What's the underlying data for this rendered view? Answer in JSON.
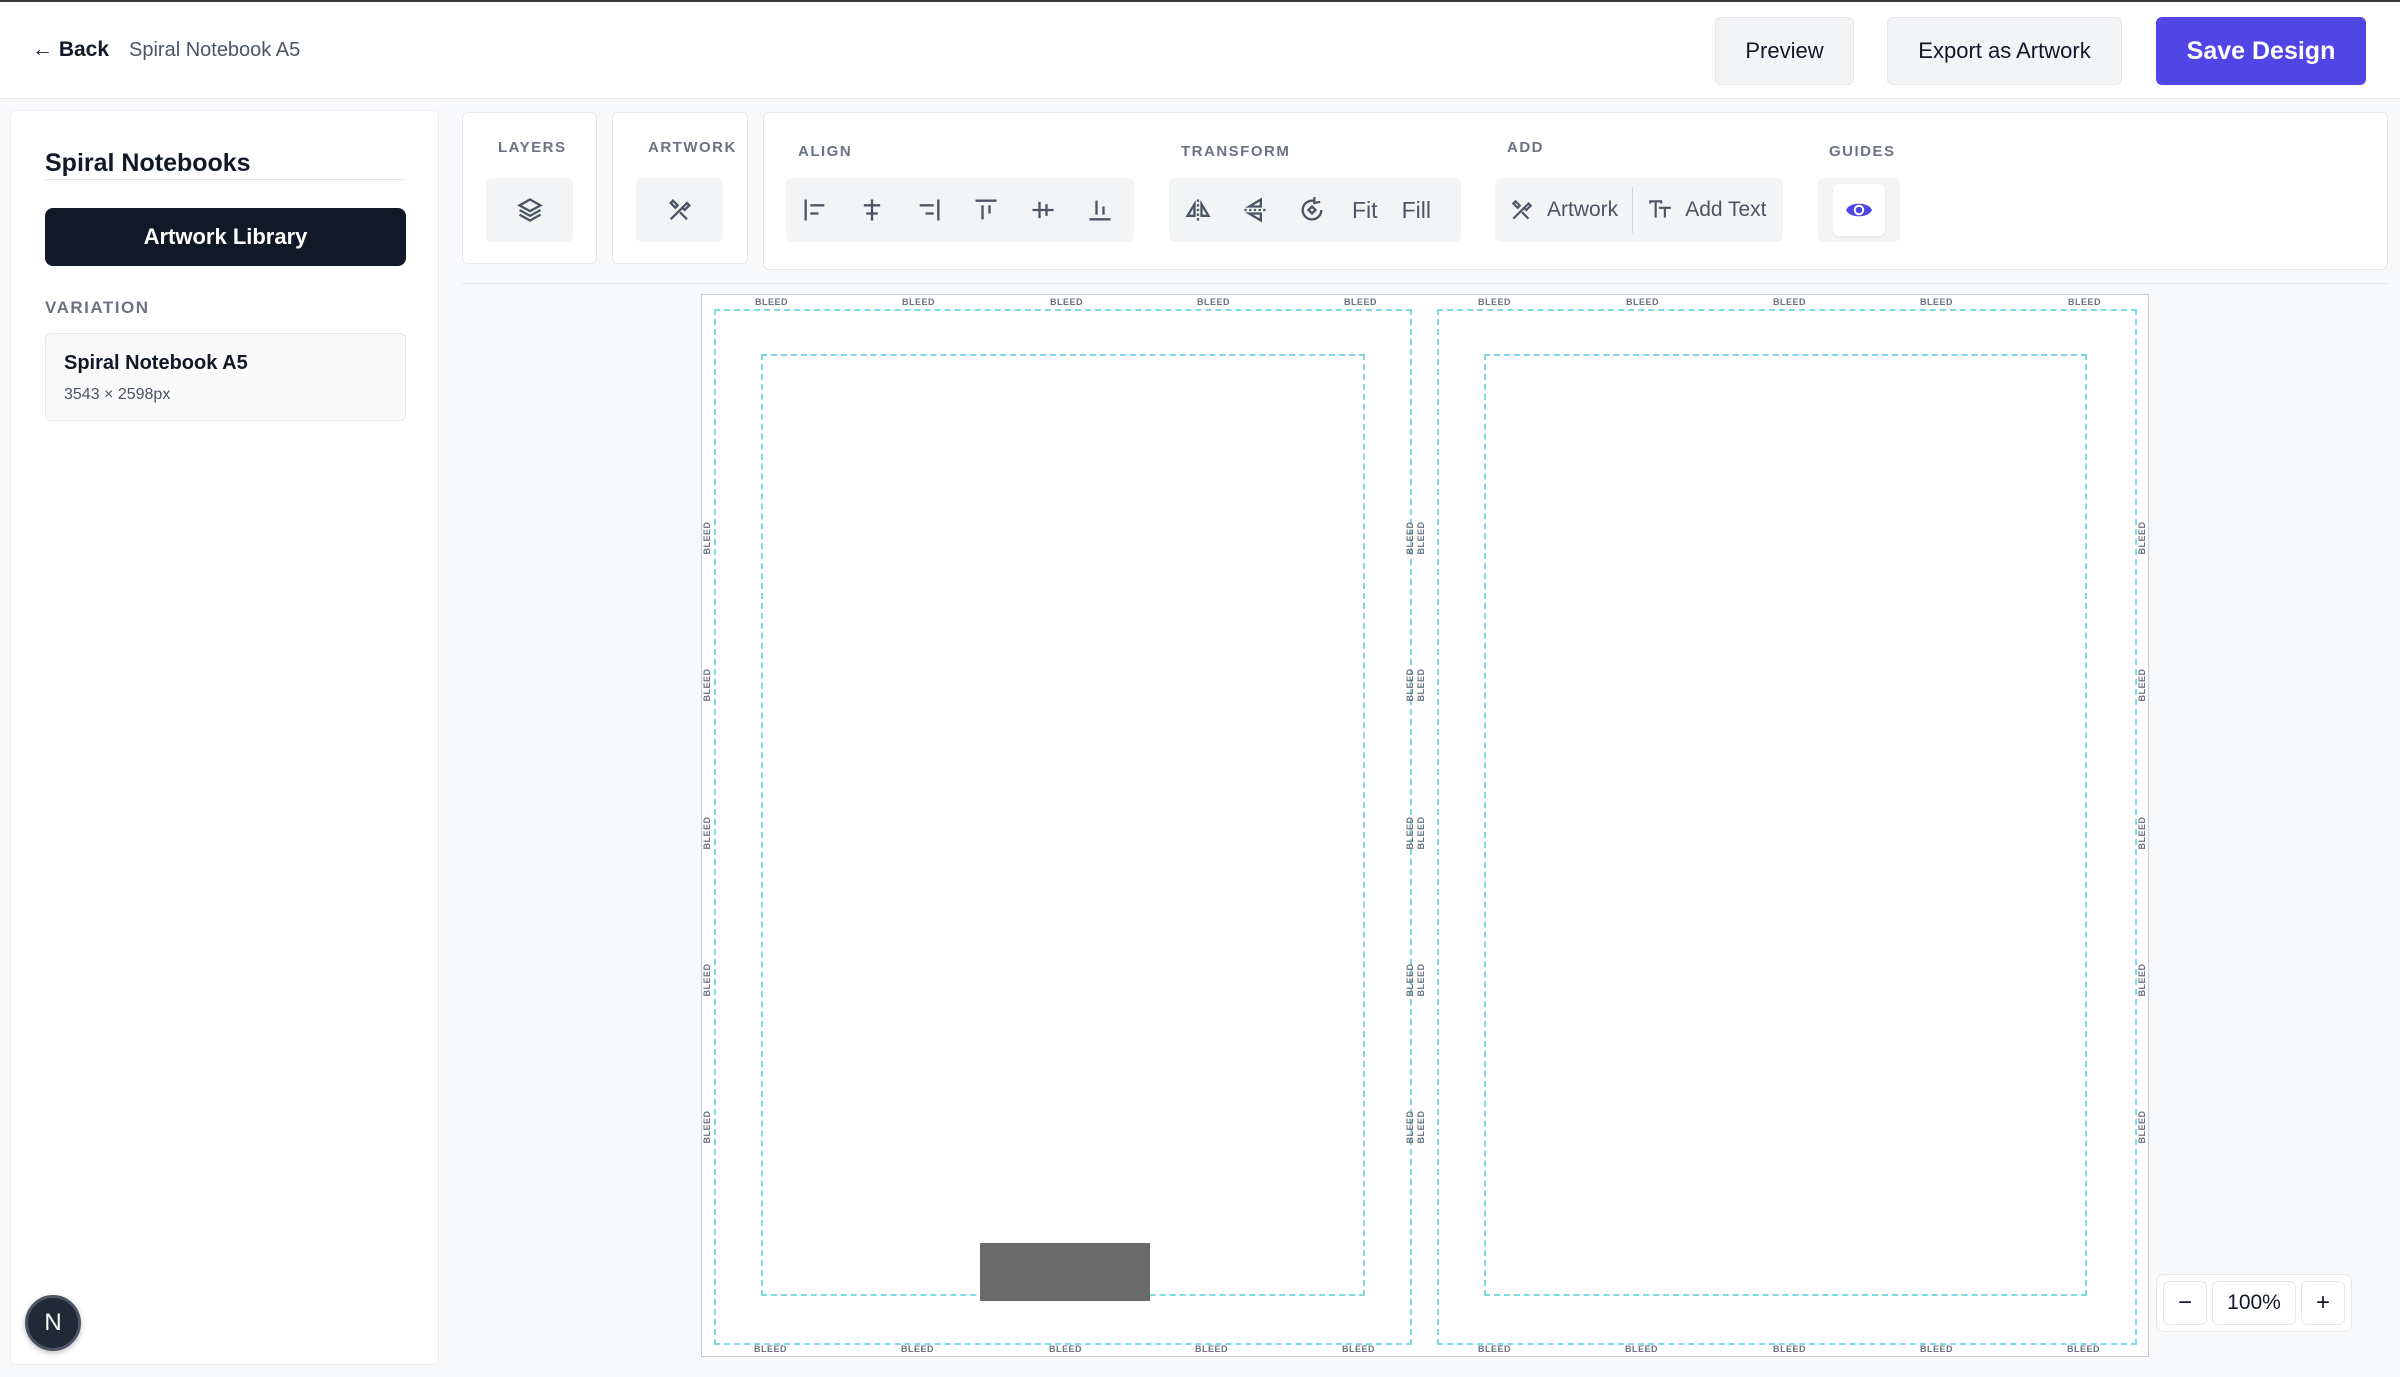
{
  "header": {
    "back_label": "← Back",
    "doc_title": "Spiral Notebook A5",
    "preview_label": "Preview",
    "export_label": "Export as Artwork",
    "save_label": "Save Design",
    "accent_color": "#4f46e5"
  },
  "sidebar": {
    "title": "Spiral Notebooks",
    "library_button": "Artwork Library",
    "section_label": "VARIATION",
    "variation": {
      "name": "Spiral Notebook A5",
      "dims": "3543 × 2598px"
    },
    "avatar_letter": "N"
  },
  "toolbar": {
    "layers_label": "LAYERS",
    "artwork_label": "ARTWORK",
    "align_label": "ALIGN",
    "transform_label": "TRANSFORM",
    "add_label": "ADD",
    "guides_label": "GUIDES",
    "fit_label": "Fit",
    "fill_label": "Fill",
    "add_artwork_label": "Artwork",
    "add_text_label": "Add Text",
    "icons": [
      "layers-icon",
      "artwork-icon",
      "align-left-icon",
      "align-center-h-icon",
      "align-right-icon",
      "align-top-icon",
      "align-center-v-icon",
      "align-bottom-icon",
      "flip-horizontal-icon",
      "flip-vertical-icon",
      "rotate-icon",
      "artwork-icon",
      "text-icon",
      "eye-icon"
    ]
  },
  "canvas": {
    "bleed_label": "BLEED",
    "guide_color": "#7fdbe3"
  },
  "zoom": {
    "minus": "−",
    "value": "100%",
    "plus": "+"
  }
}
